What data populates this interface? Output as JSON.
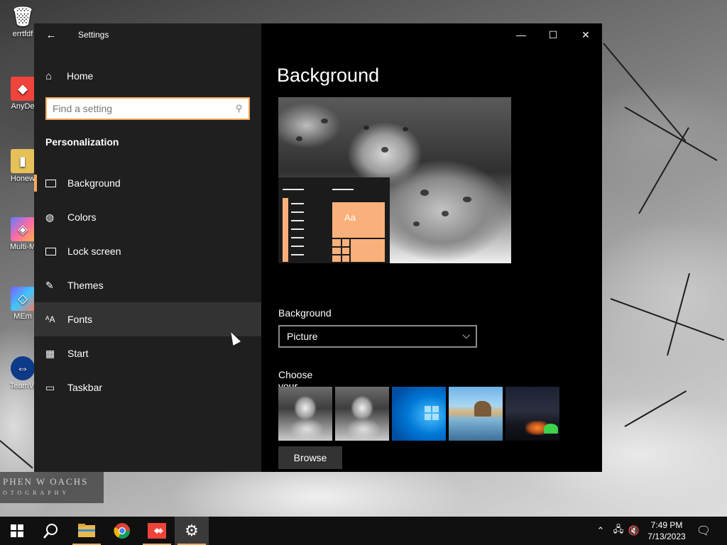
{
  "desktop": {
    "icons": [
      {
        "label": "errtfdf",
        "icon": "recycle-bin-icon"
      },
      {
        "label": "AnyDe",
        "icon": "anydesk-icon"
      },
      {
        "label": "Honew",
        "icon": "folder-icon"
      },
      {
        "label": "Multi-M",
        "icon": "multi-app-icon"
      },
      {
        "label": "MEm",
        "icon": "memu-icon"
      },
      {
        "label": "TeamVi",
        "icon": "teamviewer-icon"
      }
    ],
    "watermark": {
      "line1": "PHEN W OACHS",
      "line2": "OTOGRAPHY"
    }
  },
  "window": {
    "app_title": "Settings",
    "controls": {
      "minimize": "—",
      "maximize": "☐",
      "close": "✕"
    }
  },
  "sidebar": {
    "home_label": "Home",
    "search_placeholder": "Find a setting",
    "section_title": "Personalization",
    "items": [
      {
        "label": "Background",
        "icon": "picture-icon"
      },
      {
        "label": "Colors",
        "icon": "palette-icon"
      },
      {
        "label": "Lock screen",
        "icon": "lock-screen-icon"
      },
      {
        "label": "Themes",
        "icon": "themes-icon"
      },
      {
        "label": "Fonts",
        "icon": "fonts-icon"
      },
      {
        "label": "Start",
        "icon": "start-icon"
      },
      {
        "label": "Taskbar",
        "icon": "taskbar-icon"
      }
    ],
    "selected": "Background",
    "hovered": "Fonts"
  },
  "main": {
    "page_title": "Background",
    "preview_tile_text": "Aa",
    "background_label": "Background",
    "background_value": "Picture",
    "choose_label": "Choose your picture",
    "thumbnails": [
      "snow-leopard",
      "snow-leopard",
      "windows-10-blue",
      "beach-rock",
      "night-sky-tent"
    ],
    "browse_label": "Browse"
  },
  "taskbar": {
    "pinned": [
      "start-icon",
      "search-icon",
      "file-explorer-icon",
      "chrome-icon",
      "anydesk-icon",
      "settings-icon"
    ],
    "clock_time": "7:49 PM",
    "clock_date": "7/13/2023",
    "accent_color": "#f7a859"
  }
}
